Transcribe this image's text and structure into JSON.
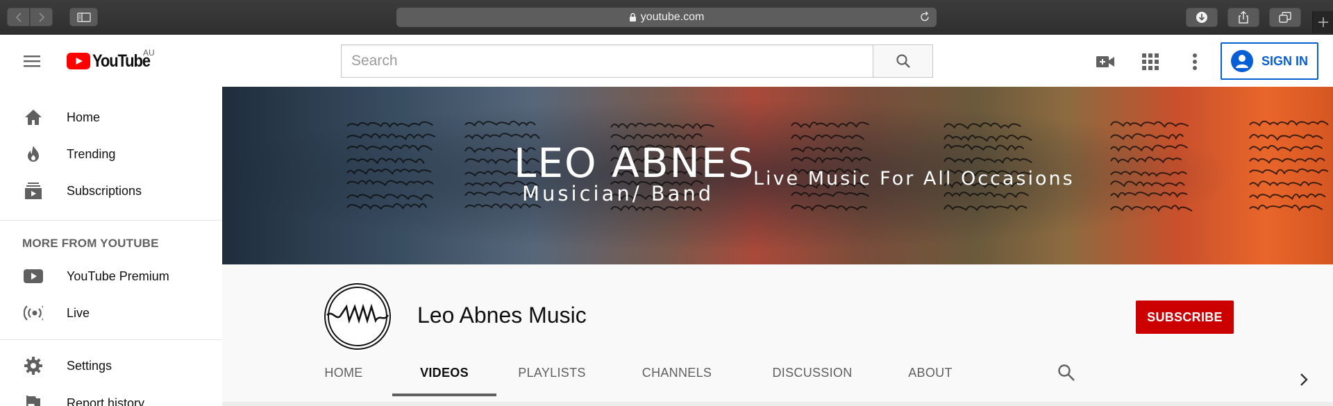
{
  "browser": {
    "url": "youtube.com"
  },
  "masthead": {
    "logo_text": "YouTube",
    "logo_country": "AU",
    "search_placeholder": "Search",
    "sign_in_label": "SIGN IN"
  },
  "sidebar": {
    "items": [
      {
        "label": "Home",
        "icon": "home-icon"
      },
      {
        "label": "Trending",
        "icon": "flame-icon"
      },
      {
        "label": "Subscriptions",
        "icon": "subscriptions-icon"
      }
    ],
    "more_heading": "MORE FROM YOUTUBE",
    "more_items": [
      {
        "label": "YouTube Premium",
        "icon": "youtube-play-icon"
      },
      {
        "label": "Live",
        "icon": "live-broadcast-icon"
      }
    ],
    "settings_items": [
      {
        "label": "Settings",
        "icon": "gear-icon"
      },
      {
        "label": "Report history",
        "icon": "flag-icon"
      }
    ]
  },
  "banner": {
    "title": "LEO ABNES",
    "subtitle": "Musician/ Band",
    "tagline": "Live Music For All Occasions"
  },
  "channel": {
    "name": "Leo Abnes Music",
    "subscribe_label": "SUBSCRIBE",
    "tabs": [
      {
        "label": "HOME",
        "active": false
      },
      {
        "label": "VIDEOS",
        "active": true
      },
      {
        "label": "PLAYLISTS",
        "active": false
      },
      {
        "label": "CHANNELS",
        "active": false
      },
      {
        "label": "DISCUSSION",
        "active": false
      },
      {
        "label": "ABOUT",
        "active": false
      }
    ]
  },
  "colors": {
    "brand_red": "#cc0000",
    "link_blue": "#065fd4",
    "text_secondary": "#606060"
  }
}
